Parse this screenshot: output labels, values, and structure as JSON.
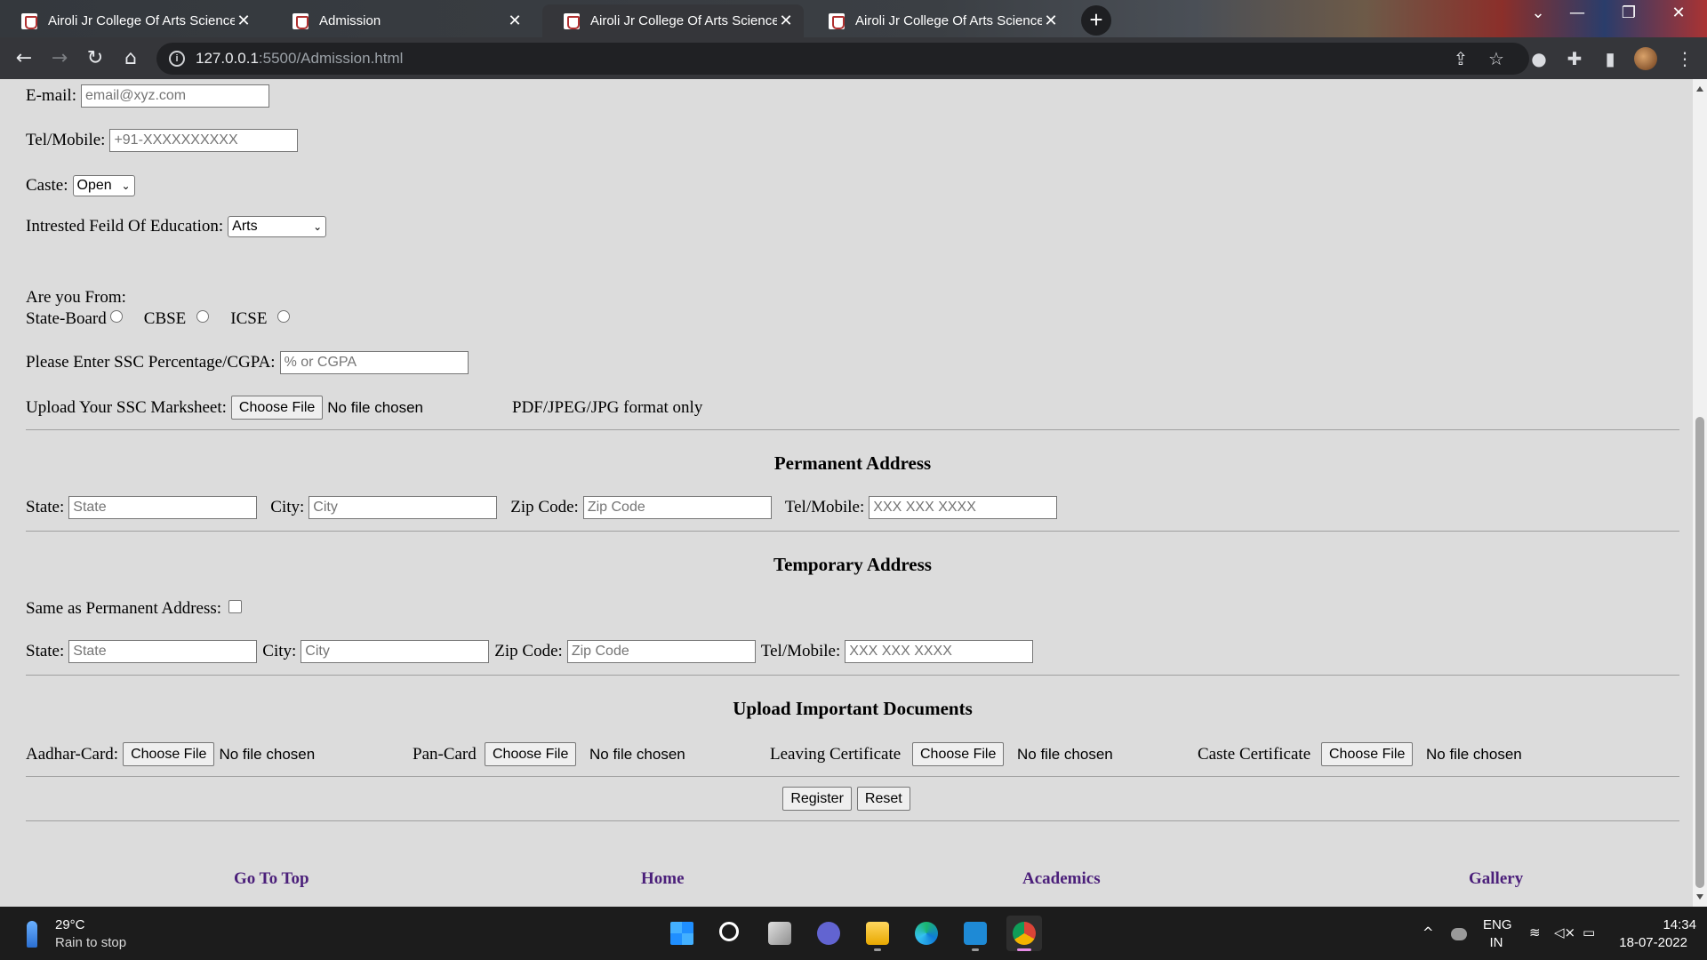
{
  "browser": {
    "tabs": [
      {
        "label": "Airoli Jr College Of Arts Science /",
        "active": false
      },
      {
        "label": "Admission",
        "active": true
      },
      {
        "label": "Airoli Jr College Of Arts Science /",
        "active": false
      },
      {
        "label": "Airoli Jr College Of Arts Science /",
        "active": false
      }
    ],
    "new_tab": "+",
    "url_host": "127.0.0.1",
    "url_path": ":5500/Admission.html"
  },
  "form": {
    "email_label": "E-mail:",
    "email_placeholder": "email@xyz.com",
    "mobile_label": "Tel/Mobile:",
    "mobile_placeholder": "+91-XXXXXXXXXX",
    "caste_label": "Caste:",
    "caste_value": "Open",
    "field_label": "Intrested Feild Of Education:",
    "field_value": "Arts",
    "board_label": "Are you From:",
    "board_options": [
      "State-Board",
      "CBSE",
      "ICSE"
    ],
    "ssc_label": "Please Enter SSC Percentage/CGPA:",
    "ssc_placeholder": "% or CGPA",
    "upload_label": "Upload Your SSC Marksheet:",
    "choose_file": "Choose File",
    "no_file": "No file chosen",
    "format_note": "PDF/JPEG/JPG format only"
  },
  "permanent": {
    "heading": "Permanent Address",
    "state_label": "State:",
    "state_placeholder": "State",
    "city_label": "City:",
    "city_placeholder": "City",
    "zip_label": "Zip Code:",
    "zip_placeholder": "Zip Code",
    "tel_label": "Tel/Mobile:",
    "tel_placeholder": "XXX XXX XXXX"
  },
  "temporary": {
    "heading": "Temporary Address",
    "same_label": "Same as Permanent Address:",
    "state_label": "State:",
    "state_placeholder": "State",
    "city_label": "City:",
    "city_placeholder": "City",
    "zip_label": "Zip Code:",
    "zip_placeholder": "Zip Code",
    "tel_label": "Tel/Mobile:",
    "tel_placeholder": "XXX XXX XXXX"
  },
  "documents": {
    "heading": "Upload Important Documents",
    "aadhar_label": "Aadhar-Card:",
    "pan_label": "Pan-Card",
    "leaving_label": "Leaving Certificate",
    "caste_label": "Caste Certificate"
  },
  "actions": {
    "register": "Register",
    "reset": "Reset"
  },
  "footer": {
    "top": "Go To Top",
    "home": "Home",
    "academics": "Academics",
    "gallery": "Gallery"
  },
  "taskbar": {
    "weather_temp": "29°C",
    "weather_desc": "Rain to stop",
    "lang": "ENG",
    "region": "IN",
    "time": "14:34",
    "date": "18-07-2022"
  },
  "colors": {
    "page_bg": "#dcdcdc",
    "footer_link": "#4b1f7a",
    "chrome_bg": "#35363a"
  }
}
